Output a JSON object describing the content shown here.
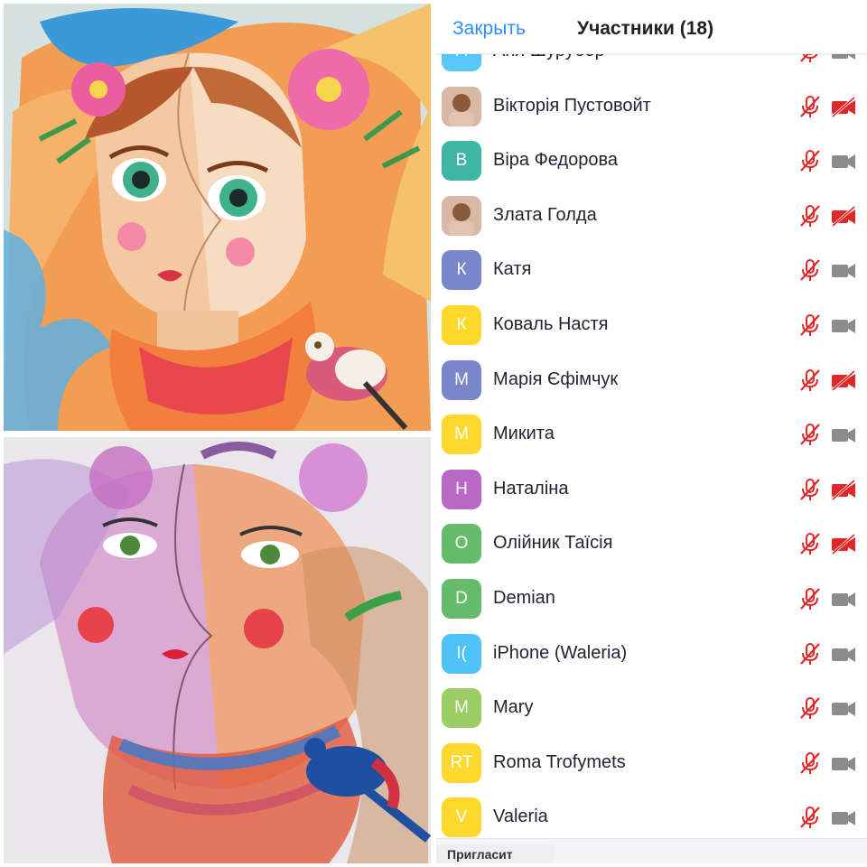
{
  "header": {
    "close_label": "Закрыть",
    "title": "Участники (18)"
  },
  "participants": [
    {
      "initials": "А",
      "name": "Аня Шурубор",
      "color": "#5ac8fa",
      "photo": false,
      "video_off": false
    },
    {
      "initials": "",
      "name": "Вікторія Пустовойт",
      "color": "#b89a8c",
      "photo": true,
      "video_off": true
    },
    {
      "initials": "В",
      "name": "Віра Федорова",
      "color": "#3fb5a3",
      "photo": false,
      "video_off": false
    },
    {
      "initials": "",
      "name": "Злата Голда",
      "color": "#c9a98f",
      "photo": true,
      "video_off": true
    },
    {
      "initials": "К",
      "name": "Катя",
      "color": "#7986cb",
      "photo": false,
      "video_off": false
    },
    {
      "initials": "К",
      "name": "Коваль Настя",
      "color": "#ffd82e",
      "photo": false,
      "video_off": false
    },
    {
      "initials": "М",
      "name": "Марія Єфімчук",
      "color": "#7986cb",
      "photo": false,
      "video_off": true
    },
    {
      "initials": "М",
      "name": "Микита",
      "color": "#ffd82e",
      "photo": false,
      "video_off": false
    },
    {
      "initials": "Н",
      "name": "Наталіна",
      "color": "#ba68c8",
      "photo": false,
      "video_off": true
    },
    {
      "initials": "О",
      "name": "Олійник Таїсія",
      "color": "#66bb6a",
      "photo": false,
      "video_off": true
    },
    {
      "initials": "D",
      "name": "Demian",
      "color": "#66bb6a",
      "photo": false,
      "video_off": false
    },
    {
      "initials": "I(",
      "name": "iPhone (Waleria)",
      "color": "#4fc3f7",
      "photo": false,
      "video_off": false
    },
    {
      "initials": "M",
      "name": "Mary",
      "color": "#9ccc65",
      "photo": false,
      "video_off": false
    },
    {
      "initials": "RT",
      "name": "Roma Trofymets",
      "color": "#ffd82e",
      "photo": false,
      "video_off": false
    },
    {
      "initials": "V",
      "name": "Valeria",
      "color": "#ffd82e",
      "photo": false,
      "video_off": false
    }
  ],
  "footer": {
    "invite_label": "Пригласит"
  },
  "colors": {
    "accent": "#2d8cff",
    "muted_red": "#e02828",
    "camera_gray": "#8c8c8c"
  },
  "icons": [
    "mic-muted-icon",
    "camera-icon",
    "camera-off-icon"
  ]
}
